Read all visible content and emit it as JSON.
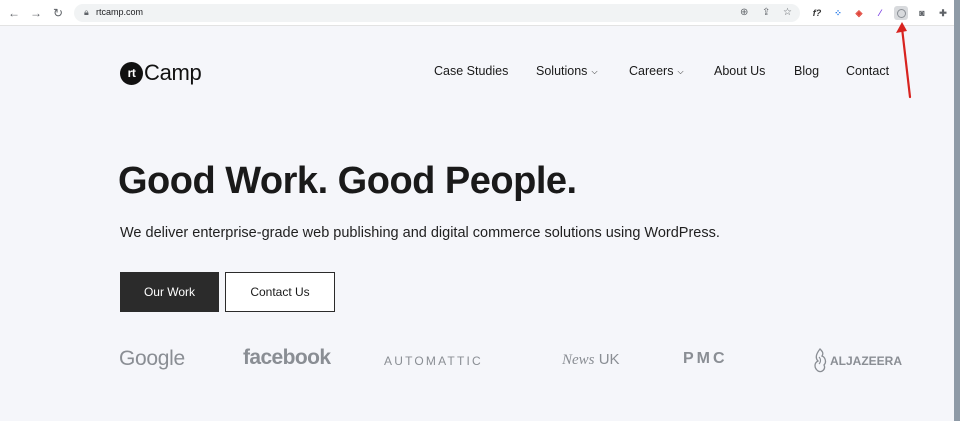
{
  "browser": {
    "url": "rtcamp.com",
    "nav_icons": [
      "back-icon",
      "forward-icon",
      "reload-icon"
    ],
    "address_icons": [
      "install-app-icon",
      "share-icon",
      "bookmark-star-icon"
    ],
    "extensions": [
      {
        "name": "formula-extension-icon",
        "glyph": "f?"
      },
      {
        "name": "grid-extension-icon",
        "glyph": "⁘"
      },
      {
        "name": "red-extension-icon",
        "glyph": "◈"
      },
      {
        "name": "pen-extension-icon",
        "glyph": "⁄"
      },
      {
        "name": "circle-extension-icon",
        "glyph": ""
      },
      {
        "name": "camera-extension-icon",
        "glyph": "◙"
      },
      {
        "name": "puzzle-extension-icon",
        "glyph": "✚"
      }
    ]
  },
  "site": {
    "logo_rt": "rt",
    "logo_camp": "Camp",
    "nav": {
      "case_studies": "Case Studies",
      "solutions": "Solutions",
      "careers": "Careers",
      "about": "About Us",
      "blog": "Blog",
      "contact": "Contact"
    },
    "hero": {
      "title": "Good Work. Good People.",
      "subtitle": "We deliver enterprise-grade web publishing and digital commerce solutions using WordPress.",
      "primary_cta": "Our Work",
      "secondary_cta": "Contact Us"
    },
    "clients": {
      "google": "Google",
      "facebook": "facebook",
      "automattic": "AUTOMATTIC",
      "news": "News",
      "uk": "UK",
      "pmc": "PMC",
      "aljazeera": "ALJAZEERA"
    }
  },
  "colors": {
    "page_bg": "#f5f6fa",
    "button_dark": "#2b2b2b",
    "client_logo_gray": "#8a8e94",
    "annotation_red": "#d8231f"
  }
}
